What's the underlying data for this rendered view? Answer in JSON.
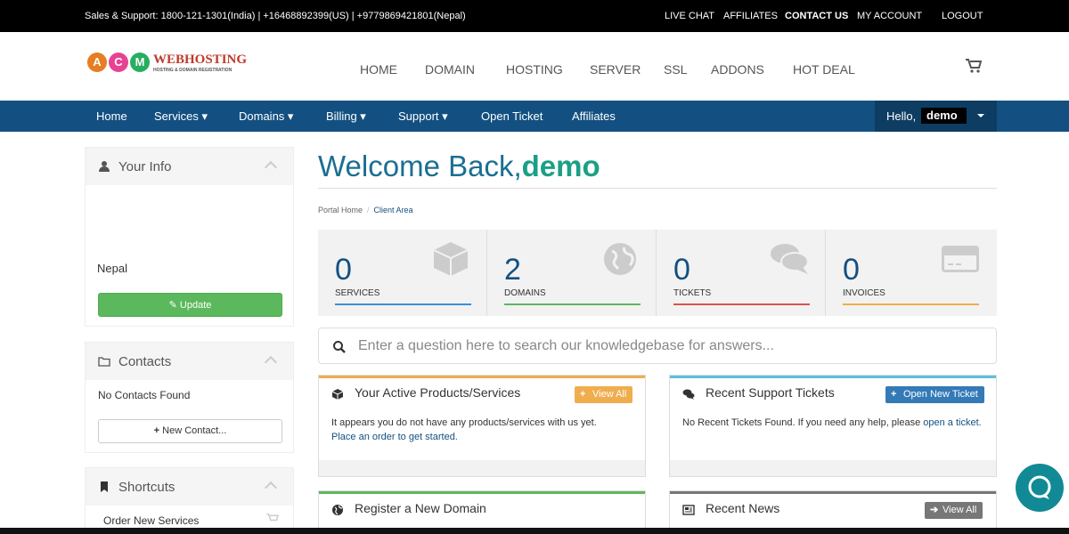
{
  "topbar": {
    "sales": "Sales & Support: 1800-121-1301(India) | +16468892399(US) | +9779869421801(Nepal)",
    "links": [
      "LIVE CHAT",
      "AFFILIATES",
      "CONTACT US",
      "MY ACCOUNT",
      "LOGOUT"
    ]
  },
  "logo": {
    "letters": [
      "A",
      "C",
      "M"
    ],
    "brand": "WEBHOSTING",
    "tagline": "HOSTING & DOMAIN REGISTRATION"
  },
  "main_nav": [
    "HOME",
    "DOMAIN",
    "HOSTING",
    "SERVER",
    "SSL",
    "ADDONS",
    "HOT DEAL"
  ],
  "blue_nav": {
    "items": [
      "Home",
      "Services",
      "Domains",
      "Billing",
      "Support",
      "Open Ticket",
      "Affiliates"
    ],
    "hello": "Hello,",
    "username": "demo"
  },
  "sidebar": {
    "your_info": {
      "title": "Your Info",
      "country": "Nepal",
      "button": "Update"
    },
    "contacts": {
      "title": "Contacts",
      "empty": "No Contacts Found",
      "button": "New Contact..."
    },
    "shortcuts": {
      "title": "Shortcuts",
      "item": "Order New Services"
    }
  },
  "welcome": {
    "prefix": "Welcome Back,",
    "name": "demo"
  },
  "breadcrumb": {
    "home": "Portal Home",
    "sep": "/",
    "current": "Client Area"
  },
  "stats": [
    {
      "count": "0",
      "label": "SERVICES",
      "color": "#3d8fd6"
    },
    {
      "count": "2",
      "label": "DOMAINS",
      "color": "#5cb85c"
    },
    {
      "count": "0",
      "label": "TICKETS",
      "color": "#d9534f"
    },
    {
      "count": "0",
      "label": "INVOICES",
      "color": "#f0ad4e"
    }
  ],
  "search": {
    "placeholder": "Enter a question here to search our knowledgebase for answers..."
  },
  "cards": {
    "products": {
      "title": "Your Active Products/Services",
      "action": "View All",
      "text": "It appears you do not have any products/services with us yet.",
      "link": "Place an order to get started."
    },
    "tickets": {
      "title": "Recent Support Tickets",
      "action": "Open New Ticket",
      "text": "No Recent Tickets Found. If you need any help, please",
      "link": "open a ticket."
    },
    "domain": {
      "title": "Register a New Domain"
    },
    "news": {
      "title": "Recent News",
      "action": "View All"
    }
  },
  "colors": {
    "brand_blue": "#135081",
    "accent_teal": "#1aa085",
    "chat": "#118a95"
  }
}
